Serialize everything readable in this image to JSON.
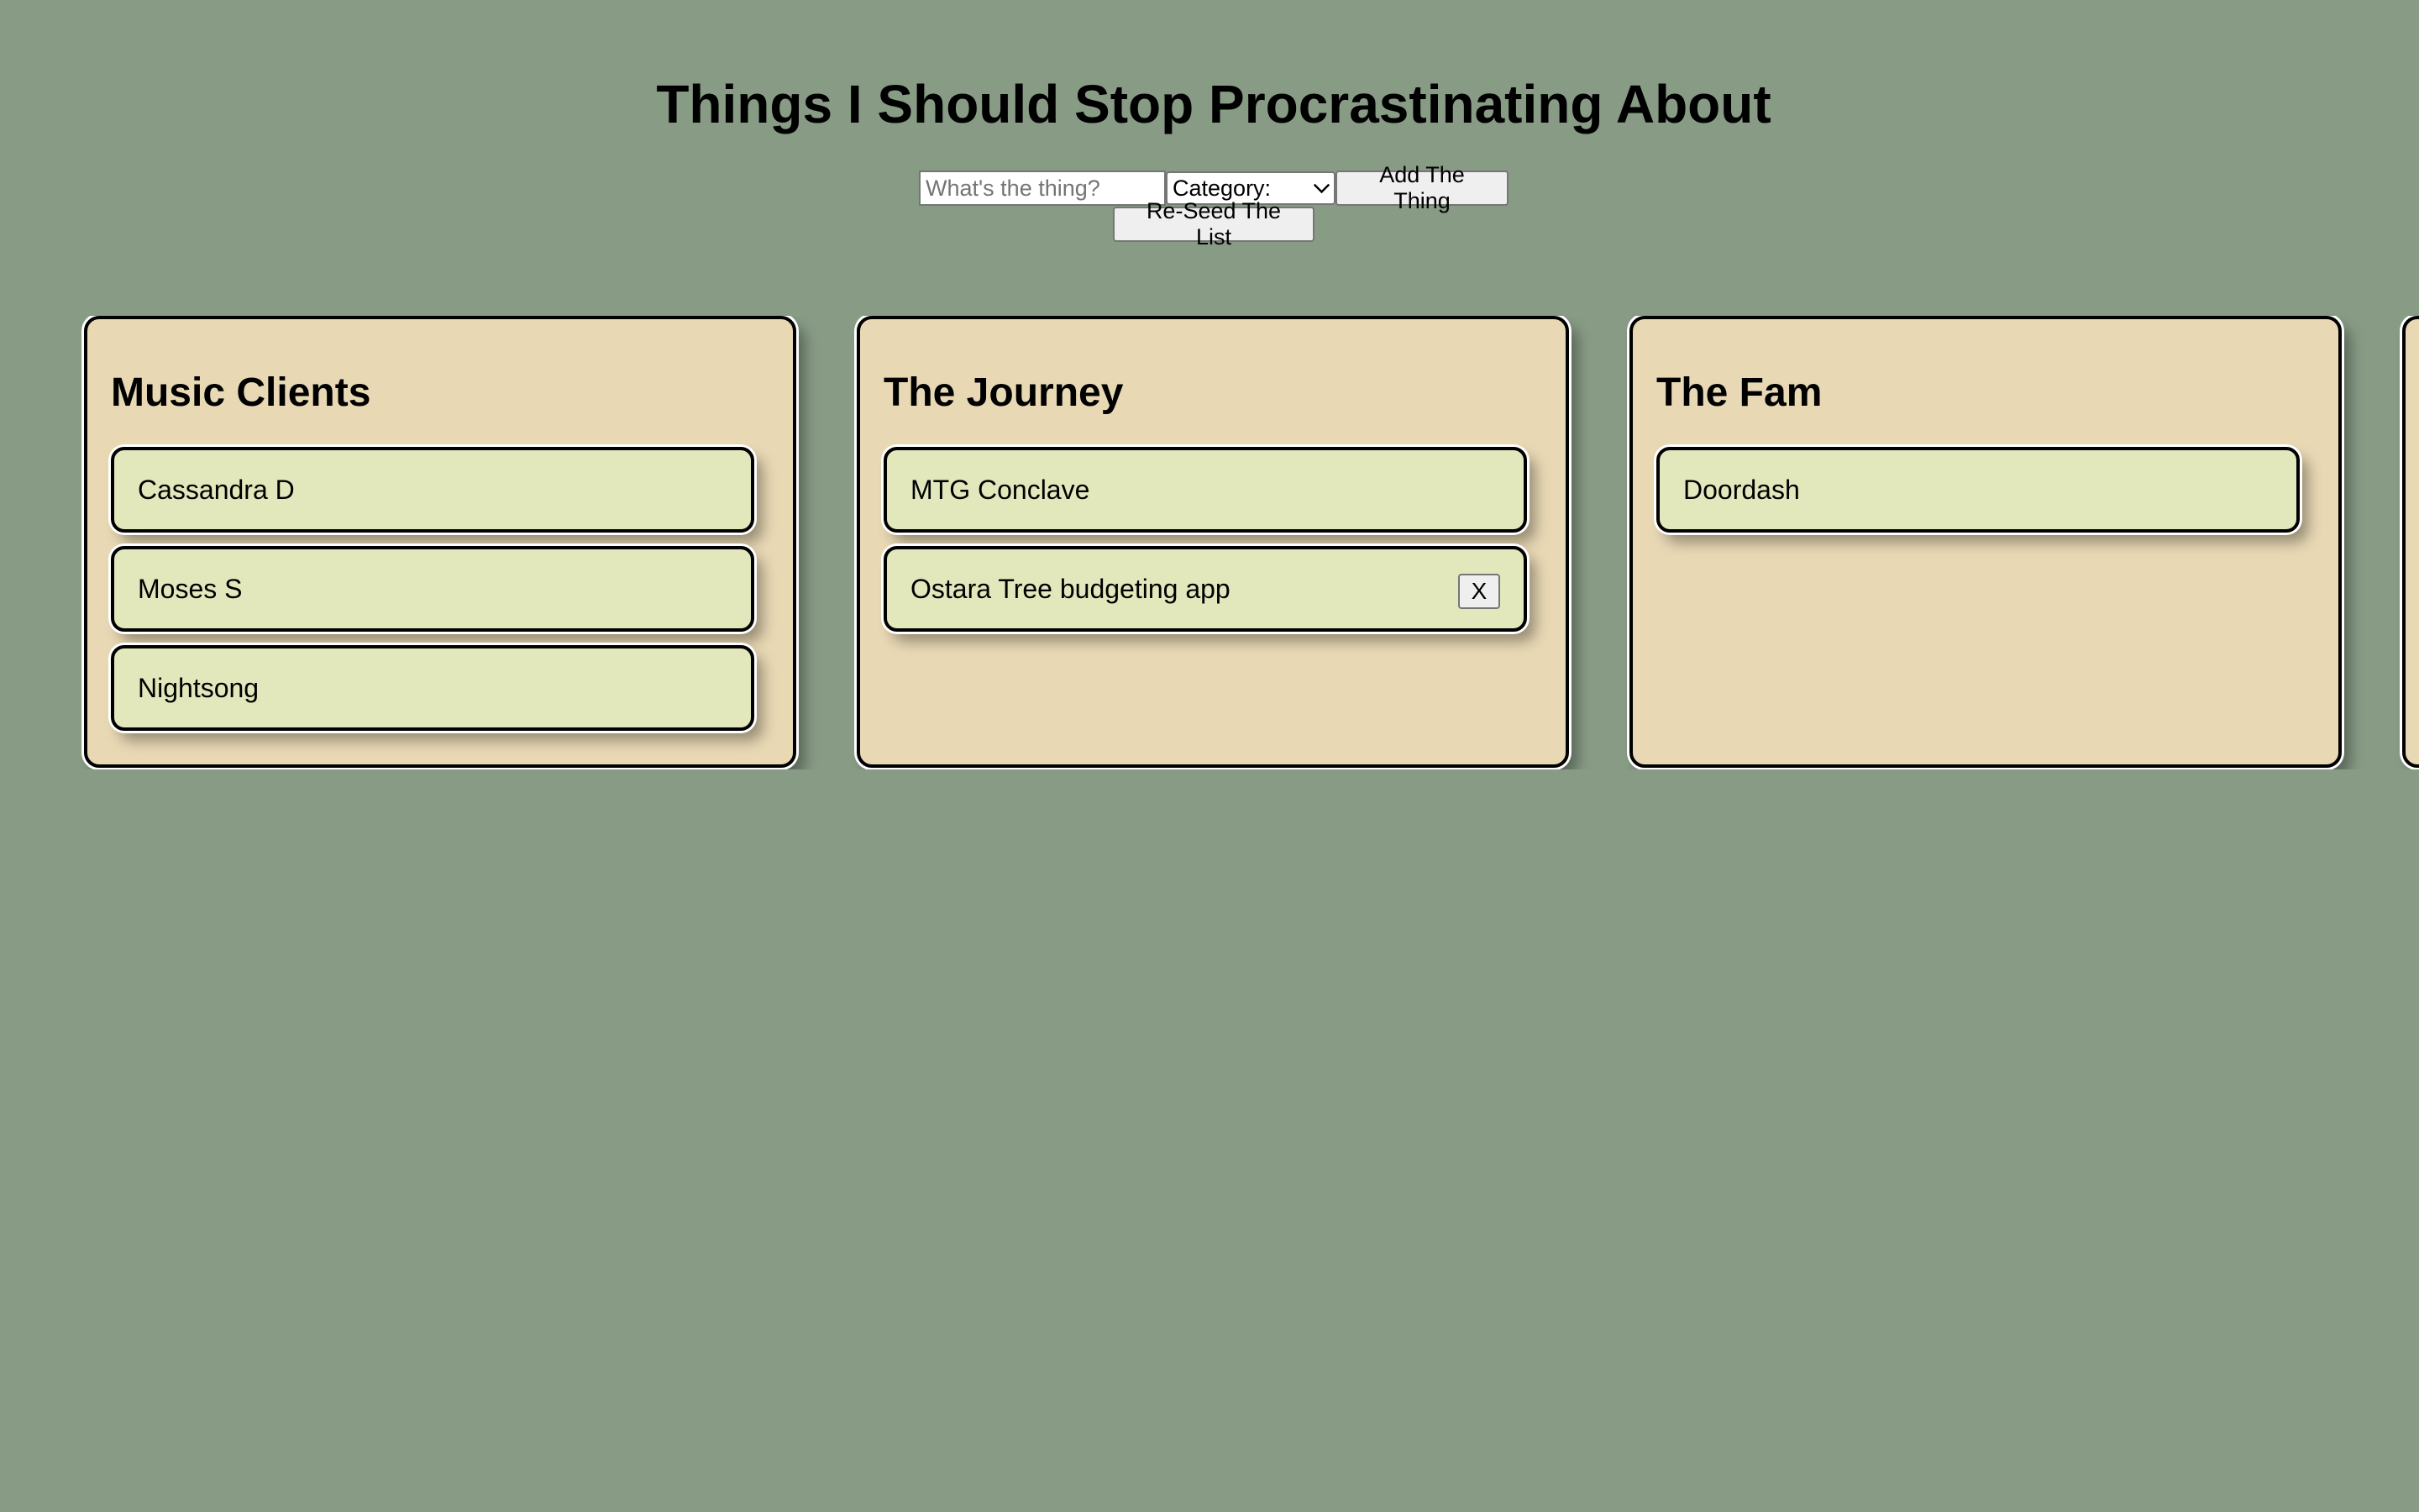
{
  "header": {
    "title": "Things I Should Stop Procrastinating About"
  },
  "form": {
    "thing_placeholder": "What's the thing?",
    "thing_value": "",
    "category_selected": "Category:",
    "add_label": "Add The Thing",
    "reseed_label": "Re-Seed The List"
  },
  "columns": [
    {
      "title": "Music Clients",
      "items": [
        {
          "label": "Cassandra D"
        },
        {
          "label": "Moses S"
        },
        {
          "label": "Nightsong"
        }
      ]
    },
    {
      "title": "The Journey",
      "items": [
        {
          "label": "MTG Conclave"
        },
        {
          "label": "Ostara Tree budgeting app",
          "delete_label": "X"
        }
      ]
    },
    {
      "title": "The Fam",
      "items": [
        {
          "label": "Doordash"
        }
      ]
    },
    {
      "title": "",
      "items": []
    }
  ],
  "colors": {
    "background": "#879b85",
    "column_bg": "#e8d8b4",
    "card_bg": "#e2e8bc"
  }
}
